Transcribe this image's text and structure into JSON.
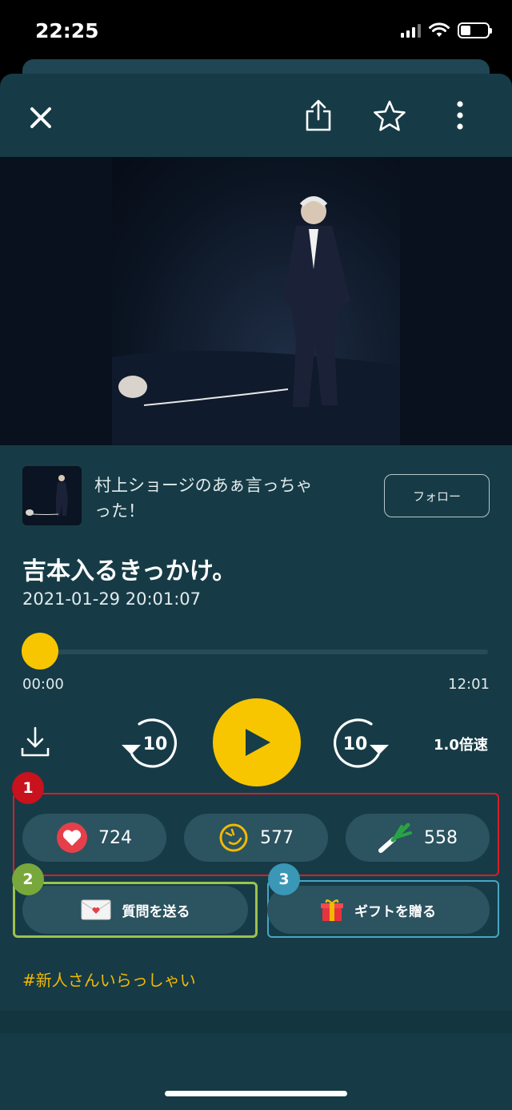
{
  "status_bar": {
    "time": "22:25",
    "battery_level": 0.3
  },
  "toolbar": {
    "close_icon": "close-icon",
    "share_icon": "share-icon",
    "favorite_icon": "star-icon",
    "more_icon": "more-vertical-icon"
  },
  "channel": {
    "name": "村上ショージのあぁ言っちゃった！",
    "follow_label": "フォロー"
  },
  "episode": {
    "title": "吉本入るきっかけ。",
    "date": "2021-01-29 20:01:07"
  },
  "player": {
    "current_time": "00:00",
    "total_time": "12:01",
    "progress": 0,
    "rewind_seconds": "10",
    "forward_seconds": "10",
    "speed_label": "1.0倍速"
  },
  "reactions": {
    "like_count": "724",
    "laugh_count": "577",
    "leek_count": "558"
  },
  "actions": {
    "question_label": "質問を送る",
    "gift_label": "ギフトを贈る"
  },
  "annotations": {
    "badge_1": "1",
    "badge_2": "2",
    "badge_3": "3"
  },
  "hashtag": "#新人さんいらっしゃい",
  "colors": {
    "background": "#163b46",
    "accent_yellow": "#f7c600",
    "pill": "#2b5360",
    "box_red": "#d81e27",
    "box_green": "#9dc24c",
    "box_blue": "#47a6c3"
  }
}
